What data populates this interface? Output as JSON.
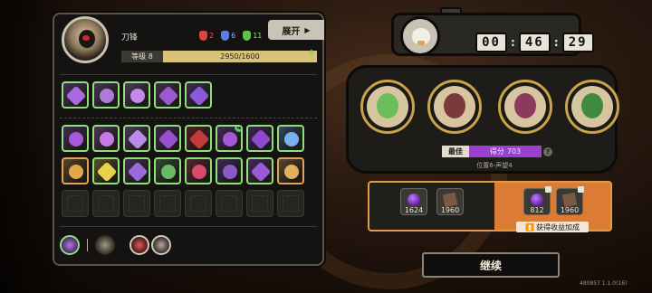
{
  "character": {
    "name": "刀锋",
    "level_label": "等级 8",
    "xp_text": "2950/1600",
    "xp_fraction": 1.0
  },
  "masks": [
    {
      "color": "#d64545",
      "count": "2"
    },
    {
      "color": "#5a7ee0",
      "count": "6"
    },
    {
      "color": "#5fc04a",
      "count": "11"
    }
  ],
  "expand_label": "展开",
  "skills_row": [
    {
      "color": "#a86ae0",
      "shape": "diamond"
    },
    {
      "color": "#b07ad8",
      "shape": "round"
    },
    {
      "color": "#c58ae8",
      "shape": "round"
    },
    {
      "color": "#9a5ad0",
      "shape": "diamond"
    },
    {
      "color": "#8c5ad8",
      "shape": "diamond"
    }
  ],
  "inventory_row1": [
    {
      "color": "#a75ad8",
      "shape": "round"
    },
    {
      "color": "#c77ae8",
      "shape": "round"
    },
    {
      "color": "#b98aea",
      "shape": "diamond"
    },
    {
      "color": "#9b4fd0",
      "shape": "diamond"
    },
    {
      "color": "#c43a3a",
      "shape": "diamond"
    },
    {
      "color": "#a25ad8",
      "shape": "round",
      "badge": "4"
    },
    {
      "color": "#8c4ad0",
      "shape": "diamond"
    },
    {
      "color": "#7ab0f0",
      "shape": "round"
    }
  ],
  "inventory_row2": [
    {
      "color": "#e0a84a",
      "shape": "round",
      "orange": true
    },
    {
      "color": "#e8d24a",
      "shape": "diamond"
    },
    {
      "color": "#9a6ad8",
      "shape": "diamond"
    },
    {
      "color": "#6ab86a",
      "shape": "round"
    },
    {
      "color": "#d64a6a",
      "shape": "round"
    },
    {
      "color": "#8a5ac8",
      "shape": "round"
    },
    {
      "color": "#9a5ad8",
      "shape": "diamond"
    },
    {
      "color": "#e0b060",
      "shape": "round",
      "orange": true
    }
  ],
  "empty_slots": 8,
  "timer": {
    "h": "00",
    "m": "46",
    "s": "29"
  },
  "team": [
    {
      "name": "hero-1",
      "color": "#6abf5a"
    },
    {
      "name": "hero-2",
      "color": "#7a3a3a"
    },
    {
      "name": "hero-3",
      "color": "#8a3a5a"
    },
    {
      "name": "hero-4",
      "color": "#3f8a3f"
    }
  ],
  "best_label": "最佳",
  "score_label": "得分",
  "score_value": "703",
  "position_text": "位置6-声望4",
  "rewards": [
    {
      "icon": "purple-orb-icon",
      "value": "1624"
    },
    {
      "icon": "brown-card-icon",
      "value": "1960"
    }
  ],
  "bonus_rewards": [
    {
      "icon": "purple-orb-icon",
      "value": "812"
    },
    {
      "icon": "brown-card-icon",
      "value": "1960"
    }
  ],
  "bonus_label": "获得收益加成",
  "continue_label": "继续",
  "version_text": "480857 1.1.0(16)"
}
